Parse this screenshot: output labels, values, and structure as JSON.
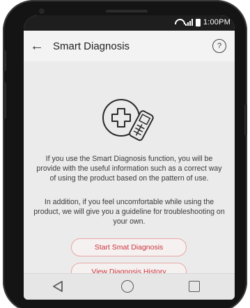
{
  "status_bar": {
    "time": "1:00PM"
  },
  "app_bar": {
    "title": "Smart Diagnosis",
    "back_icon": "←",
    "help_icon": "?"
  },
  "content": {
    "paragraph_1": "If you use the Smart Diagnosis function, you will be provide with the useful information such as a correct way of using the product based on the pattern of use.",
    "paragraph_2": "In addition, if you feel uncomfortable while using the product, we will give you a guideline for troubleshooting on your own."
  },
  "buttons": {
    "start": "Start Smat Diagnosis",
    "history": "View Diagnosis History"
  },
  "colors": {
    "accent": "#c8343c",
    "button_border": "#e9a5a5"
  },
  "icons": [
    "wifi-icon",
    "signal-icon",
    "battery-icon",
    "back-arrow-icon",
    "help-icon",
    "medical-phone-icon",
    "nav-back-icon",
    "nav-home-icon",
    "nav-recent-icon"
  ]
}
